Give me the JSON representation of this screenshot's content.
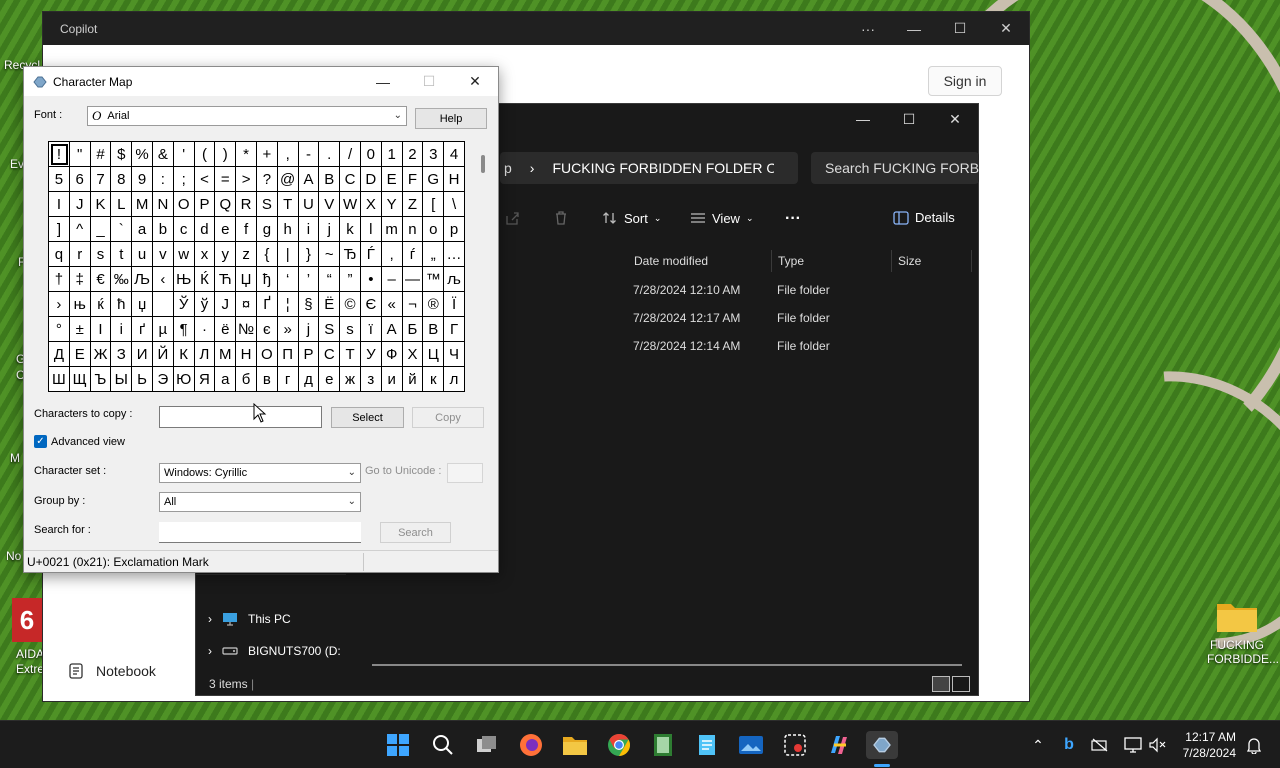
{
  "desktop": {
    "edge_labels": [
      "Recycl",
      "Ev",
      "F",
      "G",
      "C",
      "M",
      "No",
      "AIDA",
      "Extre"
    ],
    "folder_icon_label_1": "FUCKING",
    "folder_icon_label_2": "FORBIDDE..."
  },
  "copilot": {
    "title": "Copilot",
    "more": "···",
    "sign_in": "Sign in",
    "notebook": "Notebook"
  },
  "explorer": {
    "breadcrumb_tail": "p",
    "breadcrumb_sep": "›",
    "breadcrumb": "FUCKING FORBIDDEN FOLDER ON \\",
    "search_placeholder": "Search FUCKING FORBID",
    "sort": "Sort",
    "view": "View",
    "more": "···",
    "details": "Details",
    "columns": {
      "date": "Date modified",
      "type": "Type",
      "size": "Size"
    },
    "rows": [
      {
        "date": "7/28/2024 12:10 AM",
        "type": "File folder"
      },
      {
        "date": "7/28/2024 12:17 AM",
        "type": "File folder"
      },
      {
        "date": "7/28/2024 12:14 AM",
        "type": "File folder"
      }
    ],
    "nav": [
      {
        "label": "This PC"
      },
      {
        "label": "BIGNUTS700 (D:"
      }
    ],
    "status": "3 items"
  },
  "charmap": {
    "title": "Character Map",
    "font_label": "Font :",
    "font_value": "Arial",
    "font_icon": "O",
    "help": "Help",
    "chars": [
      "!",
      "\"",
      "#",
      "$",
      "%",
      "&",
      "'",
      "(",
      ")",
      "*",
      "+",
      ",",
      "-",
      ".",
      "/",
      "0",
      "1",
      "2",
      "3",
      "4",
      "5",
      "6",
      "7",
      "8",
      "9",
      ":",
      ";",
      "<",
      "=",
      ">",
      "?",
      "@",
      "A",
      "B",
      "C",
      "D",
      "E",
      "F",
      "G",
      "H",
      "I",
      "J",
      "K",
      "L",
      "M",
      "N",
      "O",
      "P",
      "Q",
      "R",
      "S",
      "T",
      "U",
      "V",
      "W",
      "X",
      "Y",
      "Z",
      "[",
      "\\",
      "]",
      "^",
      "_",
      "`",
      "a",
      "b",
      "c",
      "d",
      "e",
      "f",
      "g",
      "h",
      "i",
      "j",
      "k",
      "l",
      "m",
      "n",
      "o",
      "p",
      "q",
      "r",
      "s",
      "t",
      "u",
      "v",
      "w",
      "x",
      "y",
      "z",
      "{",
      "|",
      "}",
      "~",
      "Ђ",
      "Ѓ",
      "‚",
      "ѓ",
      "„",
      "…",
      "†",
      "‡",
      "€",
      "‰",
      "Љ",
      "‹",
      "Њ",
      "Ќ",
      "Ћ",
      "Џ",
      "ђ",
      "‘",
      "’",
      "“",
      "”",
      "•",
      "–",
      "—",
      "™",
      "љ",
      "›",
      "њ",
      "ќ",
      "ћ",
      "џ",
      " ",
      "Ў",
      "ў",
      "Ј",
      "¤",
      "Ґ",
      "¦",
      "§",
      "Ё",
      "©",
      "Є",
      "«",
      "¬",
      "®",
      "Ї",
      "°",
      "±",
      "І",
      "і",
      "ґ",
      "µ",
      "¶",
      "·",
      "ё",
      "№",
      "є",
      "»",
      "ј",
      "Ѕ",
      "ѕ",
      "ї",
      "А",
      "Б",
      "В",
      "Г",
      "Д",
      "Е",
      "Ж",
      "З",
      "И",
      "Й",
      "К",
      "Л",
      "М",
      "Н",
      "О",
      "П",
      "Р",
      "С",
      "Т",
      "У",
      "Ф",
      "Х",
      "Ц",
      "Ч",
      "Ш",
      "Щ",
      "Ъ",
      "Ы",
      "Ь",
      "Э",
      "Ю",
      "Я",
      "а",
      "б",
      "в",
      "г",
      "д",
      "е",
      "ж",
      "з",
      "и",
      "й",
      "к",
      "л"
    ],
    "chars_to_copy_label": "Characters to copy :",
    "chars_to_copy_value": "",
    "select": "Select",
    "copy": "Copy",
    "advanced_view": "Advanced view",
    "character_set_label": "Character set :",
    "character_set_value": "Windows: Cyrillic",
    "goto_unicode_label": "Go to Unicode :",
    "group_by_label": "Group by :",
    "group_by_value": "All",
    "search_for_label": "Search for :",
    "search": "Search",
    "status": "U+0021 (0x21): Exclamation Mark"
  },
  "taskbar": {
    "time": "12:17 AM",
    "date": "7/28/2024"
  },
  "colors": {
    "taskbar_bg": "#1c1c1c",
    "explorer_bg": "#191919",
    "windows_blue": "#0078d4",
    "folder_yellow": "#f3c744"
  }
}
